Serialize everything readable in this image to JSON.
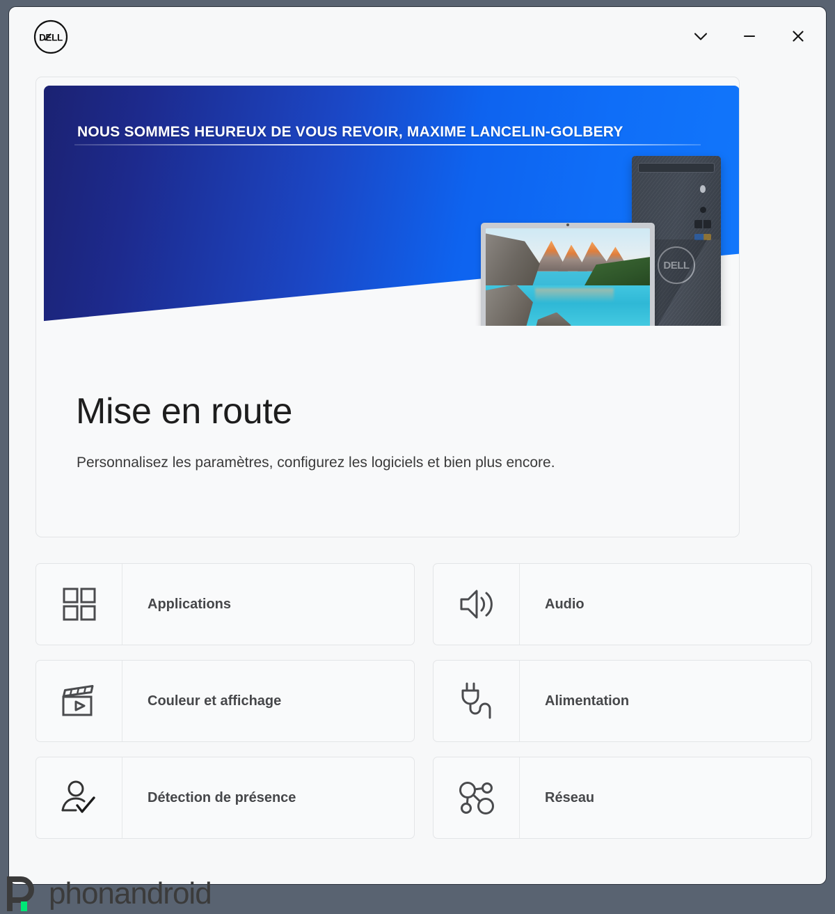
{
  "window": {
    "brand_logo": "dell-logo",
    "brand_text": "DELL",
    "controls": [
      {
        "name": "chevron-down-icon",
        "label": "Réduire le volet"
      },
      {
        "name": "minimize-icon",
        "label": "Réduire"
      },
      {
        "name": "close-icon",
        "label": "Fermer"
      }
    ]
  },
  "hero": {
    "banner_title": "NOUS SOMMES HEUREUX DE VOUS REVOIR, MAXIME LANCELIN-GOLBERY",
    "heading": "Mise en route",
    "subtitle": "Personnalisez les paramètres, configurez les logiciels et bien plus encore.",
    "illustration": {
      "laptop": "dell-laptop-moraine-lake-wallpaper",
      "desktop": "dell-desktop-tower",
      "tower_brand": "DELL"
    }
  },
  "tiles": [
    {
      "label": "Applications",
      "icon": "apps-grid-icon"
    },
    {
      "label": "Audio",
      "icon": "speaker-icon"
    },
    {
      "label": "Couleur et affichage",
      "icon": "clapperboard-icon"
    },
    {
      "label": "Alimentation",
      "icon": "power-plug-icon"
    },
    {
      "label": "Détection de présence",
      "icon": "person-check-icon"
    },
    {
      "label": "Réseau",
      "icon": "network-nodes-icon"
    }
  ],
  "watermark": {
    "text": "phonandroid",
    "logo": "phonandroid-p-logo",
    "accent_color": "#00e676"
  },
  "colors": {
    "banner_dark": "#1b2272",
    "banner_bright": "#1277fb",
    "window_bg": "#f7f8f9",
    "tile_bg": "#f9fafb",
    "tile_border": "#e3e5e7",
    "text_dark": "#1d1d1d",
    "tile_label": "#46474a"
  }
}
